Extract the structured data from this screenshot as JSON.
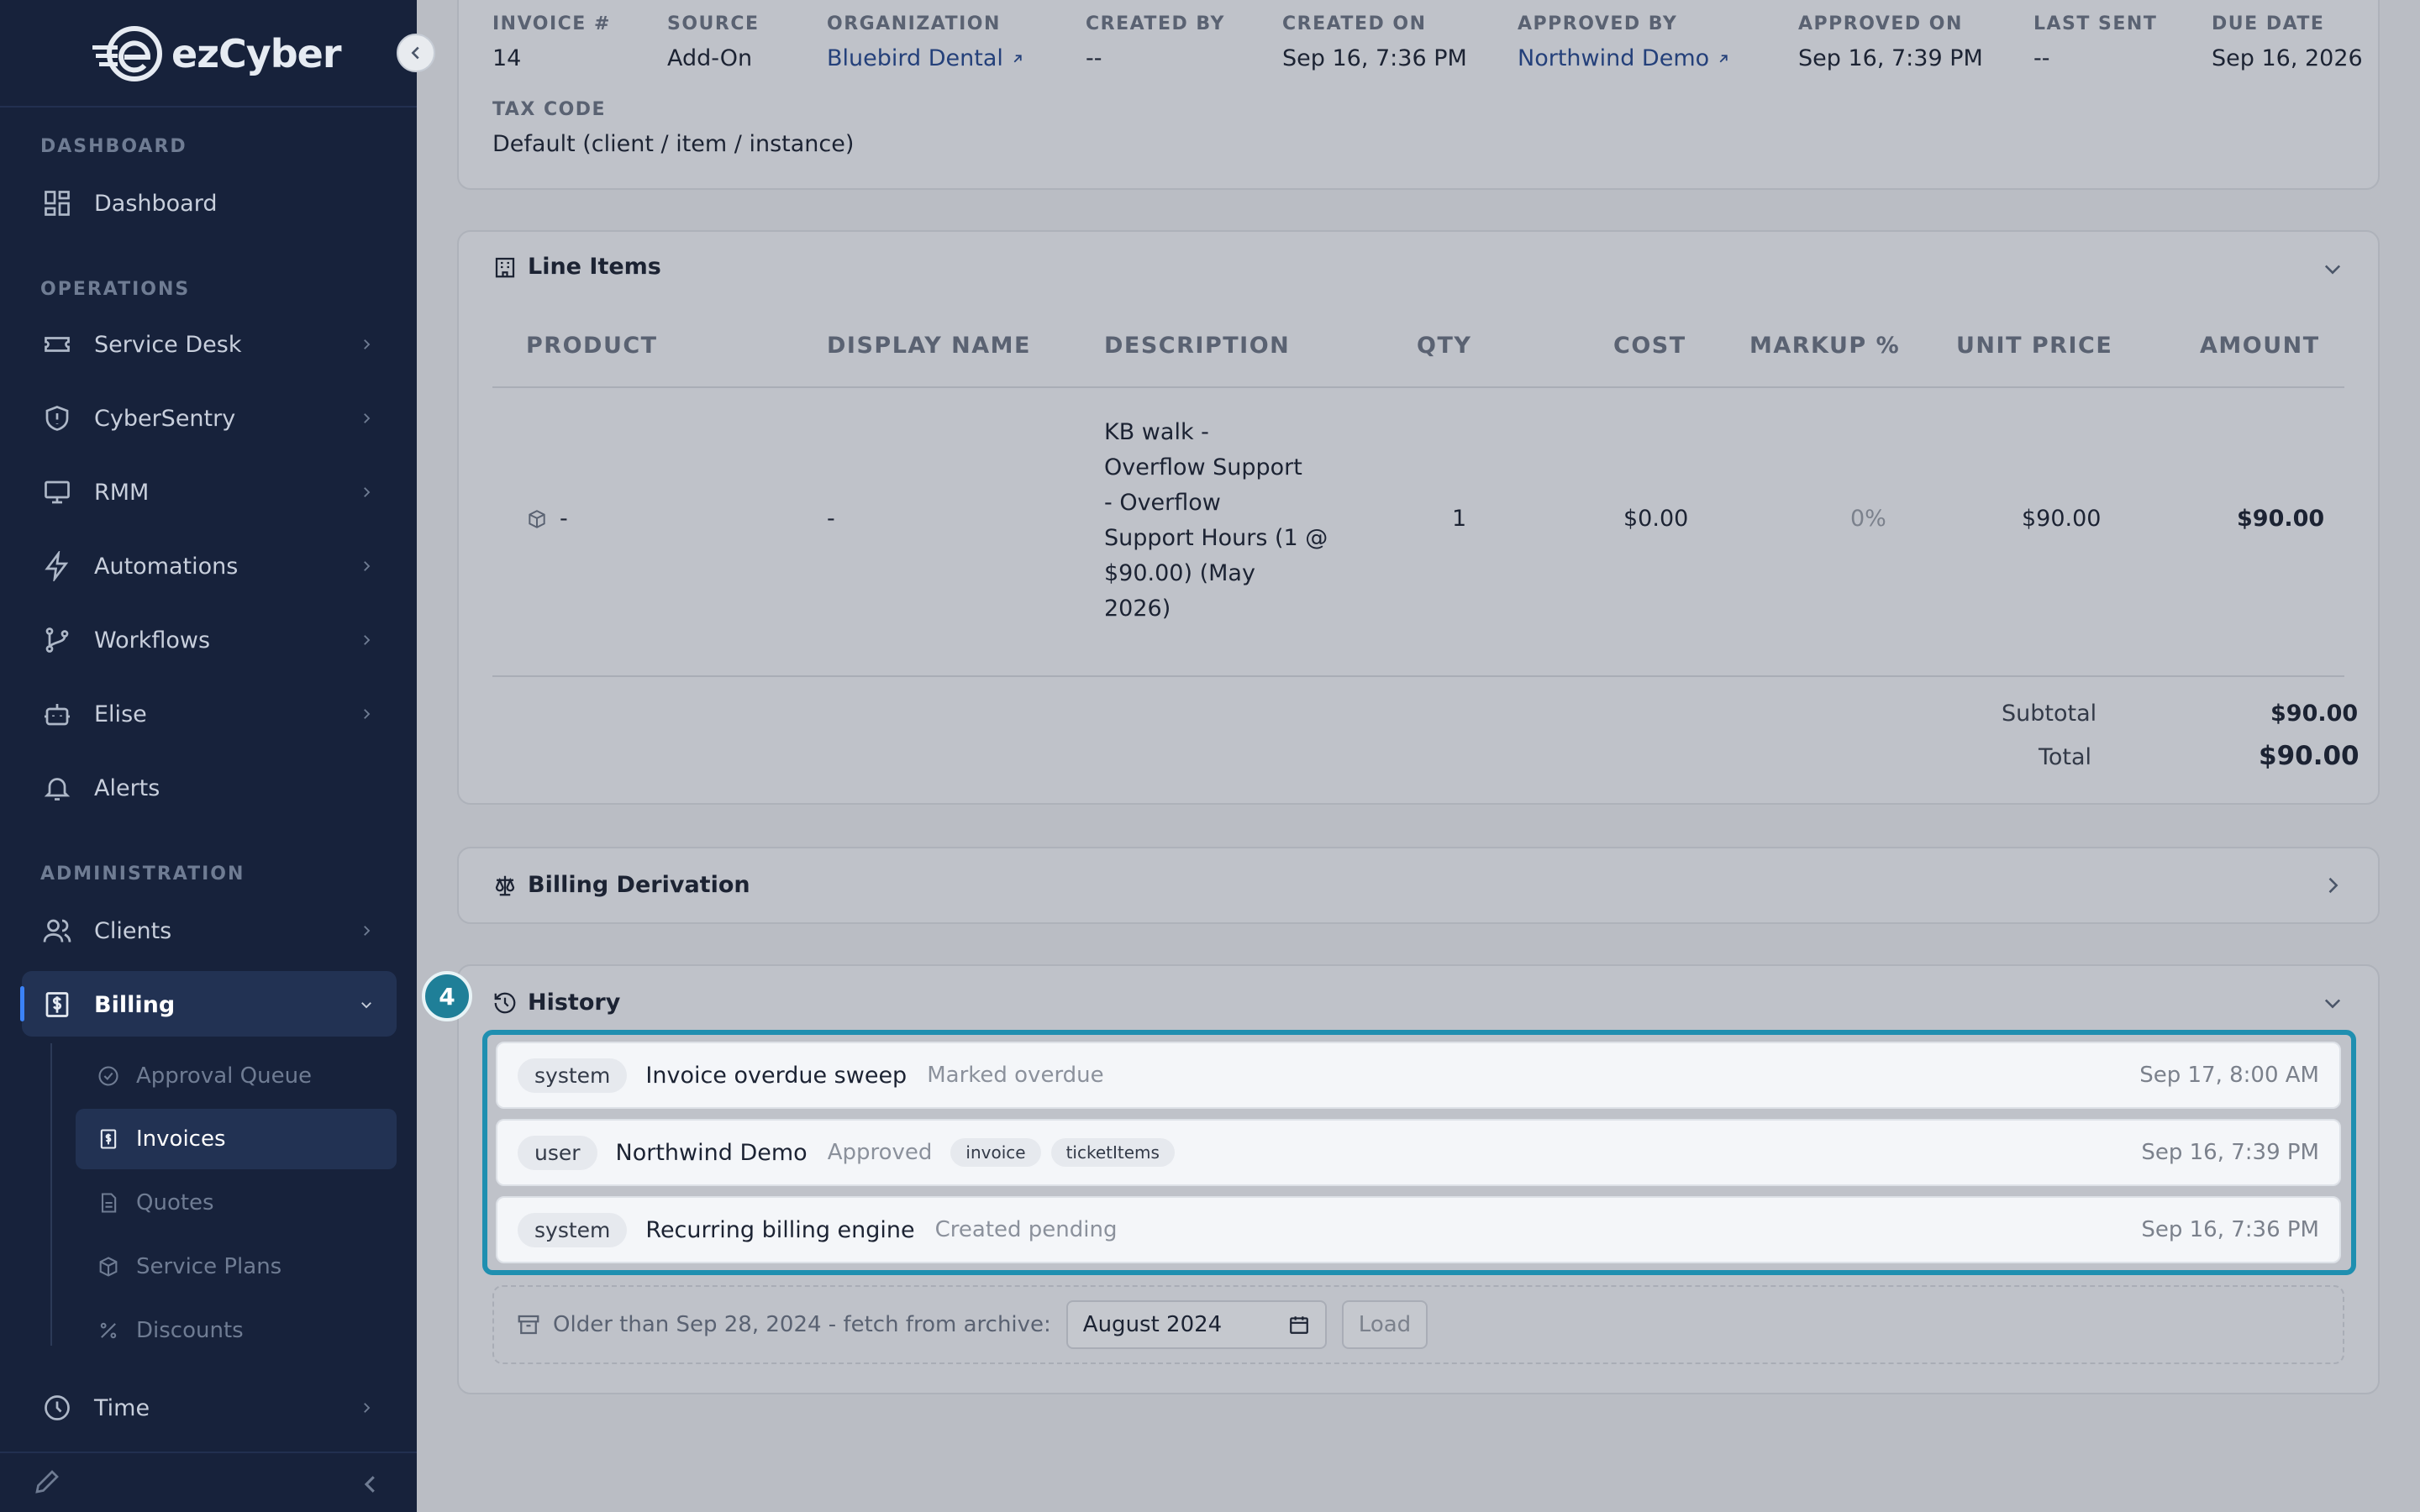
{
  "brand": {
    "name": "ezCyber"
  },
  "sidebar": {
    "sections": {
      "dashboard": "DASHBOARD",
      "operations": "OPERATIONS",
      "administration": "ADMINISTRATION"
    },
    "items": {
      "dashboard": "Dashboard",
      "service_desk": "Service Desk",
      "cybersentry": "CyberSentry",
      "rmm": "RMM",
      "automations": "Automations",
      "workflows": "Workflows",
      "elise": "Elise",
      "alerts": "Alerts",
      "clients": "Clients",
      "billing": "Billing",
      "time": "Time"
    },
    "billing_sub": {
      "approval_queue": "Approval Queue",
      "invoices": "Invoices",
      "quotes": "Quotes",
      "service_plans": "Service Plans",
      "discounts": "Discounts"
    }
  },
  "invoice_meta": {
    "labels": {
      "invoice_no": "INVOICE #",
      "source": "SOURCE",
      "organization": "ORGANIZATION",
      "created_by": "CREATED BY",
      "created_on": "CREATED ON",
      "approved_by": "APPROVED BY",
      "approved_on": "APPROVED ON",
      "last_sent": "LAST SENT",
      "due_date": "DUE DATE",
      "tax_code": "TAX CODE"
    },
    "values": {
      "invoice_no": "14",
      "source": "Add-On",
      "organization": "Bluebird Dental",
      "created_by": "--",
      "created_on": "Sep 16, 7:36 PM",
      "approved_by": "Northwind Demo",
      "approved_on": "Sep 16, 7:39 PM",
      "last_sent": "--",
      "due_date": "Sep 16, 2026",
      "tax_code": "Default (client / item / instance)"
    }
  },
  "line_items": {
    "title": "Line Items",
    "columns": {
      "product": "PRODUCT",
      "display_name": "DISPLAY NAME",
      "description": "DESCRIPTION",
      "qty": "QTY",
      "cost": "COST",
      "markup": "MARKUP %",
      "unit_price": "UNIT PRICE",
      "amount": "AMOUNT"
    },
    "rows": [
      {
        "product": "-",
        "display_name": "-",
        "description_lines": [
          "KB walk -",
          "Overflow Support",
          "- Overflow",
          "Support Hours (1 @",
          "$90.00) (May",
          "2026)"
        ],
        "qty": "1",
        "cost": "$0.00",
        "markup": "0%",
        "unit_price": "$90.00",
        "amount": "$90.00"
      }
    ],
    "subtotal_label": "Subtotal",
    "subtotal": "$90.00",
    "total_label": "Total",
    "total": "$90.00"
  },
  "billing_derivation": {
    "title": "Billing Derivation"
  },
  "history": {
    "title": "History",
    "step_badge": "4",
    "entries": [
      {
        "type": "system",
        "actor": "Invoice overdue sweep",
        "action": "Marked overdue",
        "tags": [],
        "time": "Sep 17, 8:00 AM"
      },
      {
        "type": "user",
        "actor": "Northwind Demo",
        "action": "Approved",
        "tags": [
          "invoice",
          "ticketItems"
        ],
        "time": "Sep 16, 7:39 PM"
      },
      {
        "type": "system",
        "actor": "Recurring billing engine",
        "action": "Created pending",
        "tags": [],
        "time": "Sep 16, 7:36 PM"
      }
    ],
    "archive_text": "Older than Sep 28, 2024 - fetch from archive:",
    "archive_month": "August 2024",
    "load_label": "Load"
  },
  "colors": {
    "sidebar": "#17223b",
    "accent": "#1f8fb0",
    "link": "#24407a"
  }
}
